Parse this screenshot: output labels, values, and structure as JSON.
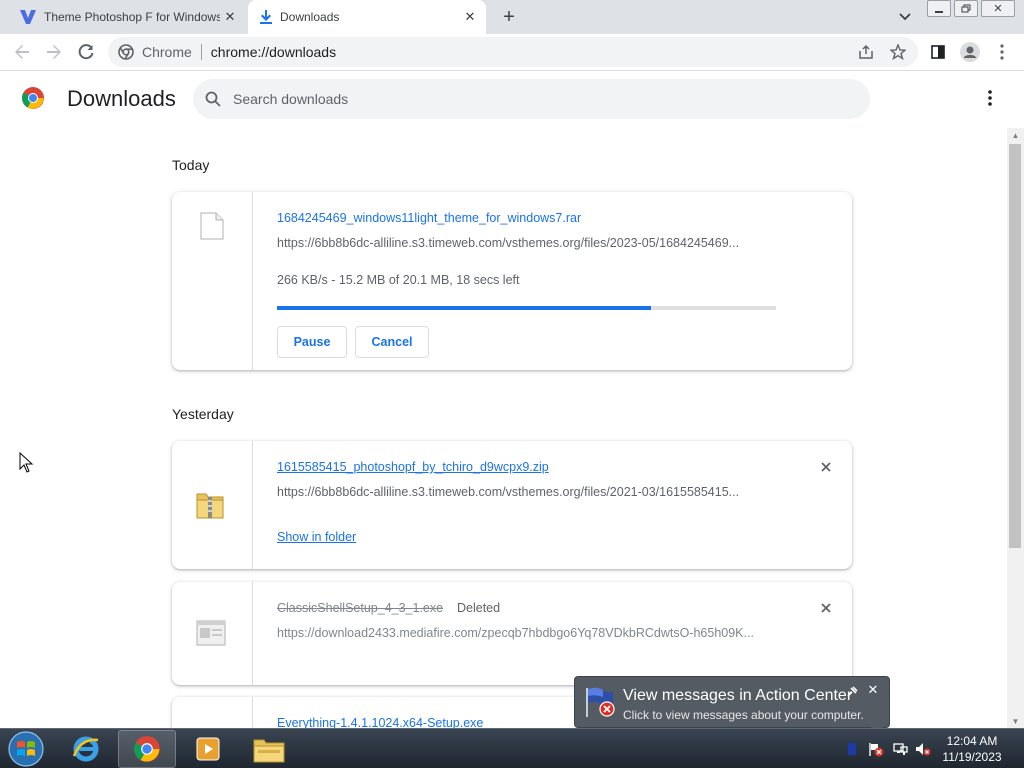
{
  "tabs": [
    {
      "title": "Theme Photoshop F for Windows",
      "icon": "v-site-icon",
      "active": false
    },
    {
      "title": "Downloads",
      "icon": "download-icon",
      "active": true
    }
  ],
  "omnibox": {
    "site_label": "Chrome",
    "url": "chrome://downloads"
  },
  "downloads_page": {
    "title": "Downloads",
    "search_placeholder": "Search downloads"
  },
  "sections": {
    "today": "Today",
    "yesterday": "Yesterday"
  },
  "items": [
    {
      "file_name": "1684245469_windows11light_theme_for_windows7.rar",
      "url": "https://6bb8b6dc-alliline.s3.timeweb.com/vsthemes.org/files/2023-05/1684245469...",
      "status": "266 KB/s - 15.2 MB of 20.1 MB, 18 secs left",
      "progress_fraction": 0.75,
      "pause_label": "Pause",
      "cancel_label": "Cancel"
    },
    {
      "file_name": "1615585415_photoshopf_by_tchiro_d9wcpx9.zip",
      "url": "https://6bb8b6dc-alliline.s3.timeweb.com/vsthemes.org/files/2021-03/1615585415...",
      "action_label": "Show in folder"
    },
    {
      "file_name": "ClassicShellSetup_4_3_1.exe",
      "state_label": "Deleted",
      "url": "https://download2433.mediafire.com/zpecqb7hbdbgo6Yq78VDkbRCdwtsO-h65h09K..."
    },
    {
      "file_name": "Everything-1.4.1.1024.x64-Setup.exe"
    }
  ],
  "balloon": {
    "title": "View messages in Action Center",
    "subtitle": "Click to view messages about your computer."
  },
  "clock": {
    "time": "12:04 AM",
    "date": "11/19/2023"
  },
  "colors": {
    "accent": "#1a73e8",
    "tab_strip": "#dee1e6",
    "progress_track": "#e0e0e0"
  }
}
